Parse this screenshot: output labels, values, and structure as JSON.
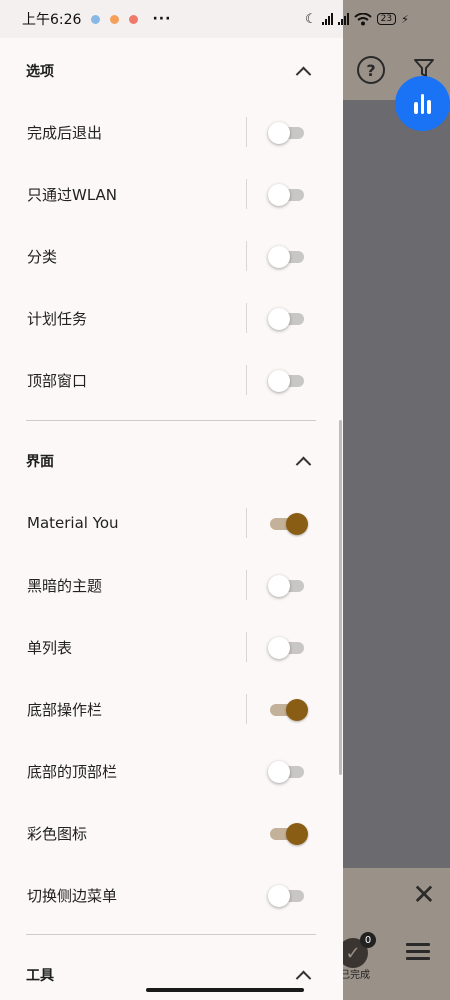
{
  "status_bar": {
    "time": "上午6:26",
    "battery": "23"
  },
  "sections": {
    "options": {
      "title": "选项",
      "items": [
        {
          "label": "完成后退出",
          "on": false,
          "separator": true
        },
        {
          "label": "只通过WLAN",
          "on": false,
          "separator": true
        },
        {
          "label": "分类",
          "on": false,
          "separator": true
        },
        {
          "label": "计划任务",
          "on": false,
          "separator": true
        },
        {
          "label": "顶部窗口",
          "on": false,
          "separator": true
        }
      ]
    },
    "interface": {
      "title": "界面",
      "items": [
        {
          "label": "Material You",
          "on": true,
          "separator": true
        },
        {
          "label": "黑暗的主题",
          "on": false,
          "separator": true
        },
        {
          "label": "单列表",
          "on": false,
          "separator": true
        },
        {
          "label": "底部操作栏",
          "on": true,
          "separator": true
        },
        {
          "label": "底部的顶部栏",
          "on": false,
          "separator": false
        },
        {
          "label": "彩色图标",
          "on": true,
          "separator": false
        },
        {
          "label": "切换侧边菜单",
          "on": false,
          "separator": false
        }
      ]
    },
    "tools": {
      "title": "工具"
    }
  },
  "background": {
    "help_symbol": "?",
    "close_symbol": "✕",
    "done_badge": "0",
    "done_label": "已完成",
    "done_check": "✓"
  },
  "colors": {
    "accent": "#8a5d14",
    "accent_track": "#c4b199",
    "fab": "#1a73f5",
    "drawer_bg": "#fbf8f7",
    "scrim": "#6b6a6e"
  }
}
